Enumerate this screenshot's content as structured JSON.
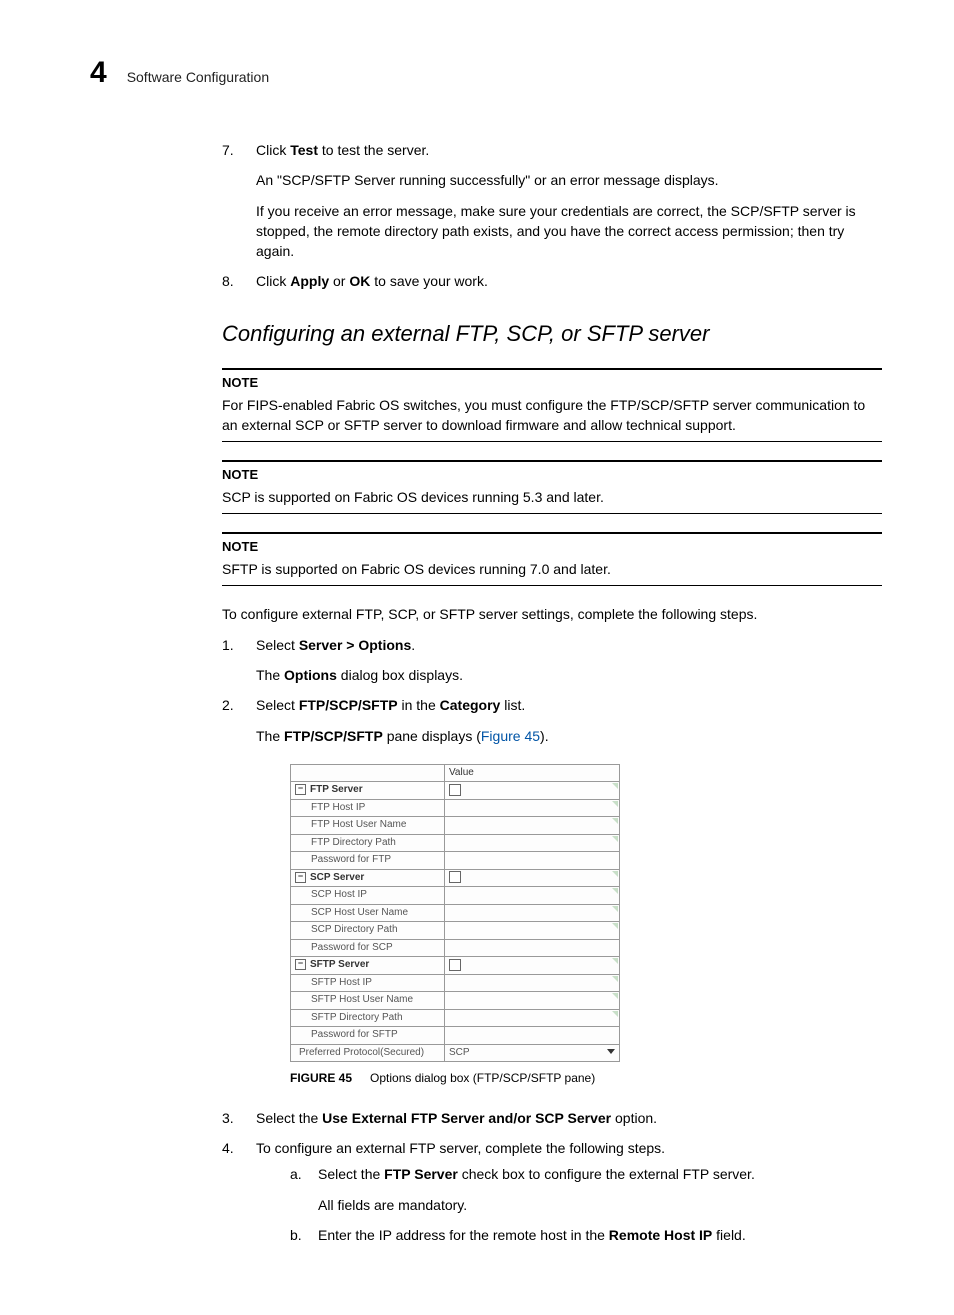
{
  "header": {
    "chapter_number": "4",
    "chapter_title": "Software Configuration"
  },
  "steps_top": {
    "s7": {
      "main_prefix": "Click ",
      "main_bold": "Test",
      "main_suffix": " to test the server.",
      "p1": "An \"SCP/SFTP Server running successfully\" or an error message displays.",
      "p2": "If you receive an error message, make sure your credentials are correct, the SCP/SFTP server is stopped, the remote directory path exists, and you have the correct access permission; then try again."
    },
    "s8": {
      "prefix": "Click ",
      "bold1": "Apply",
      "mid": " or ",
      "bold2": "OK",
      "suffix": " to save your work."
    }
  },
  "heading": "Configuring an external FTP, SCP, or SFTP server",
  "notes": {
    "label": "NOTE",
    "n1": "For FIPS-enabled Fabric OS switches, you must configure the FTP/SCP/SFTP server communication to an external SCP or SFTP server to download firmware and allow technical support.",
    "n2": "SCP is supported on Fabric OS devices running 5.3 and later.",
    "n3": "SFTP is supported on Fabric OS devices running 7.0 and later."
  },
  "intro": "To configure external FTP, SCP, or SFTP server settings, complete the following steps.",
  "steps": {
    "s1": {
      "prefix": "Select ",
      "bold": "Server > Options",
      "suffix": ".",
      "sub_prefix": "The ",
      "sub_bold": "Options",
      "sub_suffix": " dialog box displays."
    },
    "s2": {
      "prefix": "Select ",
      "bold1": "FTP/SCP/SFTP",
      "mid": " in the ",
      "bold2": "Category",
      "suffix": " list.",
      "sub_prefix": "The ",
      "sub_bold": "FTP/SCP/SFTP",
      "sub_mid": " pane displays (",
      "sub_link": "Figure 45",
      "sub_suffix": ")."
    },
    "s3": {
      "prefix": "Select the ",
      "bold": "Use External FTP Server and/or SCP Server",
      "suffix": " option."
    },
    "s4": {
      "text": "To configure an external FTP server, complete the following steps.",
      "a": {
        "prefix": "Select the ",
        "bold": "FTP Server",
        "suffix": " check box to configure the external FTP server.",
        "sub": "All fields are mandatory."
      },
      "b": {
        "prefix": "Enter the IP address for the remote host in the ",
        "bold": "Remote Host IP",
        "suffix": " field."
      }
    }
  },
  "figure": {
    "label": "FIGURE 45",
    "caption": "Options dialog box (FTP/SCP/SFTP pane)"
  },
  "table": {
    "value_header": "Value",
    "groups": [
      {
        "name": "FTP Server",
        "rows": [
          "FTP Host IP",
          "FTP Host User Name",
          "FTP Directory Path",
          "Password for FTP"
        ]
      },
      {
        "name": "SCP Server",
        "rows": [
          "SCP Host IP",
          "SCP Host User Name",
          "SCP Directory Path",
          "Password for SCP"
        ]
      },
      {
        "name": "SFTP Server",
        "rows": [
          "SFTP Host IP",
          "SFTP Host User Name",
          "SFTP Directory Path",
          "Password for SFTP"
        ]
      }
    ],
    "footer_label": "Preferred Protocol(Secured)",
    "footer_value": "SCP"
  }
}
